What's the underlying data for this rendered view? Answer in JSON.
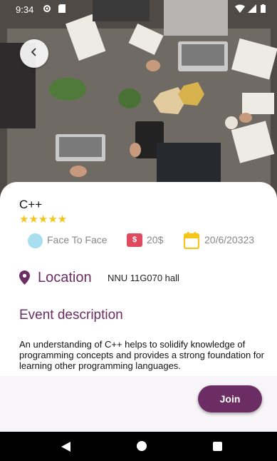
{
  "status_bar": {
    "time": "9:34",
    "icons": [
      "settings-icon",
      "sim-icon",
      "wifi-icon",
      "signal-icon",
      "battery-icon"
    ]
  },
  "hero": {
    "image": "people-working-with-laptops-at-table-photo",
    "back_icon": "chevron-left-icon"
  },
  "event": {
    "title": "C++",
    "rating": 5,
    "stars": "★★★★★",
    "mode": "Face To Face",
    "mode_icon": "circle-icon",
    "price": "20$",
    "price_icon": "price-tag-icon",
    "price_icon_text": "$",
    "date": "20/6/20323",
    "date_icon": "calendar-icon"
  },
  "location": {
    "label": "Location",
    "value": "NNU 11G070 hall",
    "icon": "location-pin-icon"
  },
  "description": {
    "title": "Event description",
    "body": "An understanding of C++ helps to solidify knowledge of programming concepts and provides a strong foundation for learning other programming languages."
  },
  "actions": {
    "join_label": "Join"
  },
  "nav_bar": {
    "icons": [
      "back-triangle-icon",
      "home-circle-icon",
      "recents-square-icon"
    ]
  },
  "colors": {
    "accent": "#6b2d64",
    "star": "#f5c518",
    "price_badge": "#e04a5e",
    "mode_circle": "#a7dff0",
    "calendar": "#f5c518"
  }
}
